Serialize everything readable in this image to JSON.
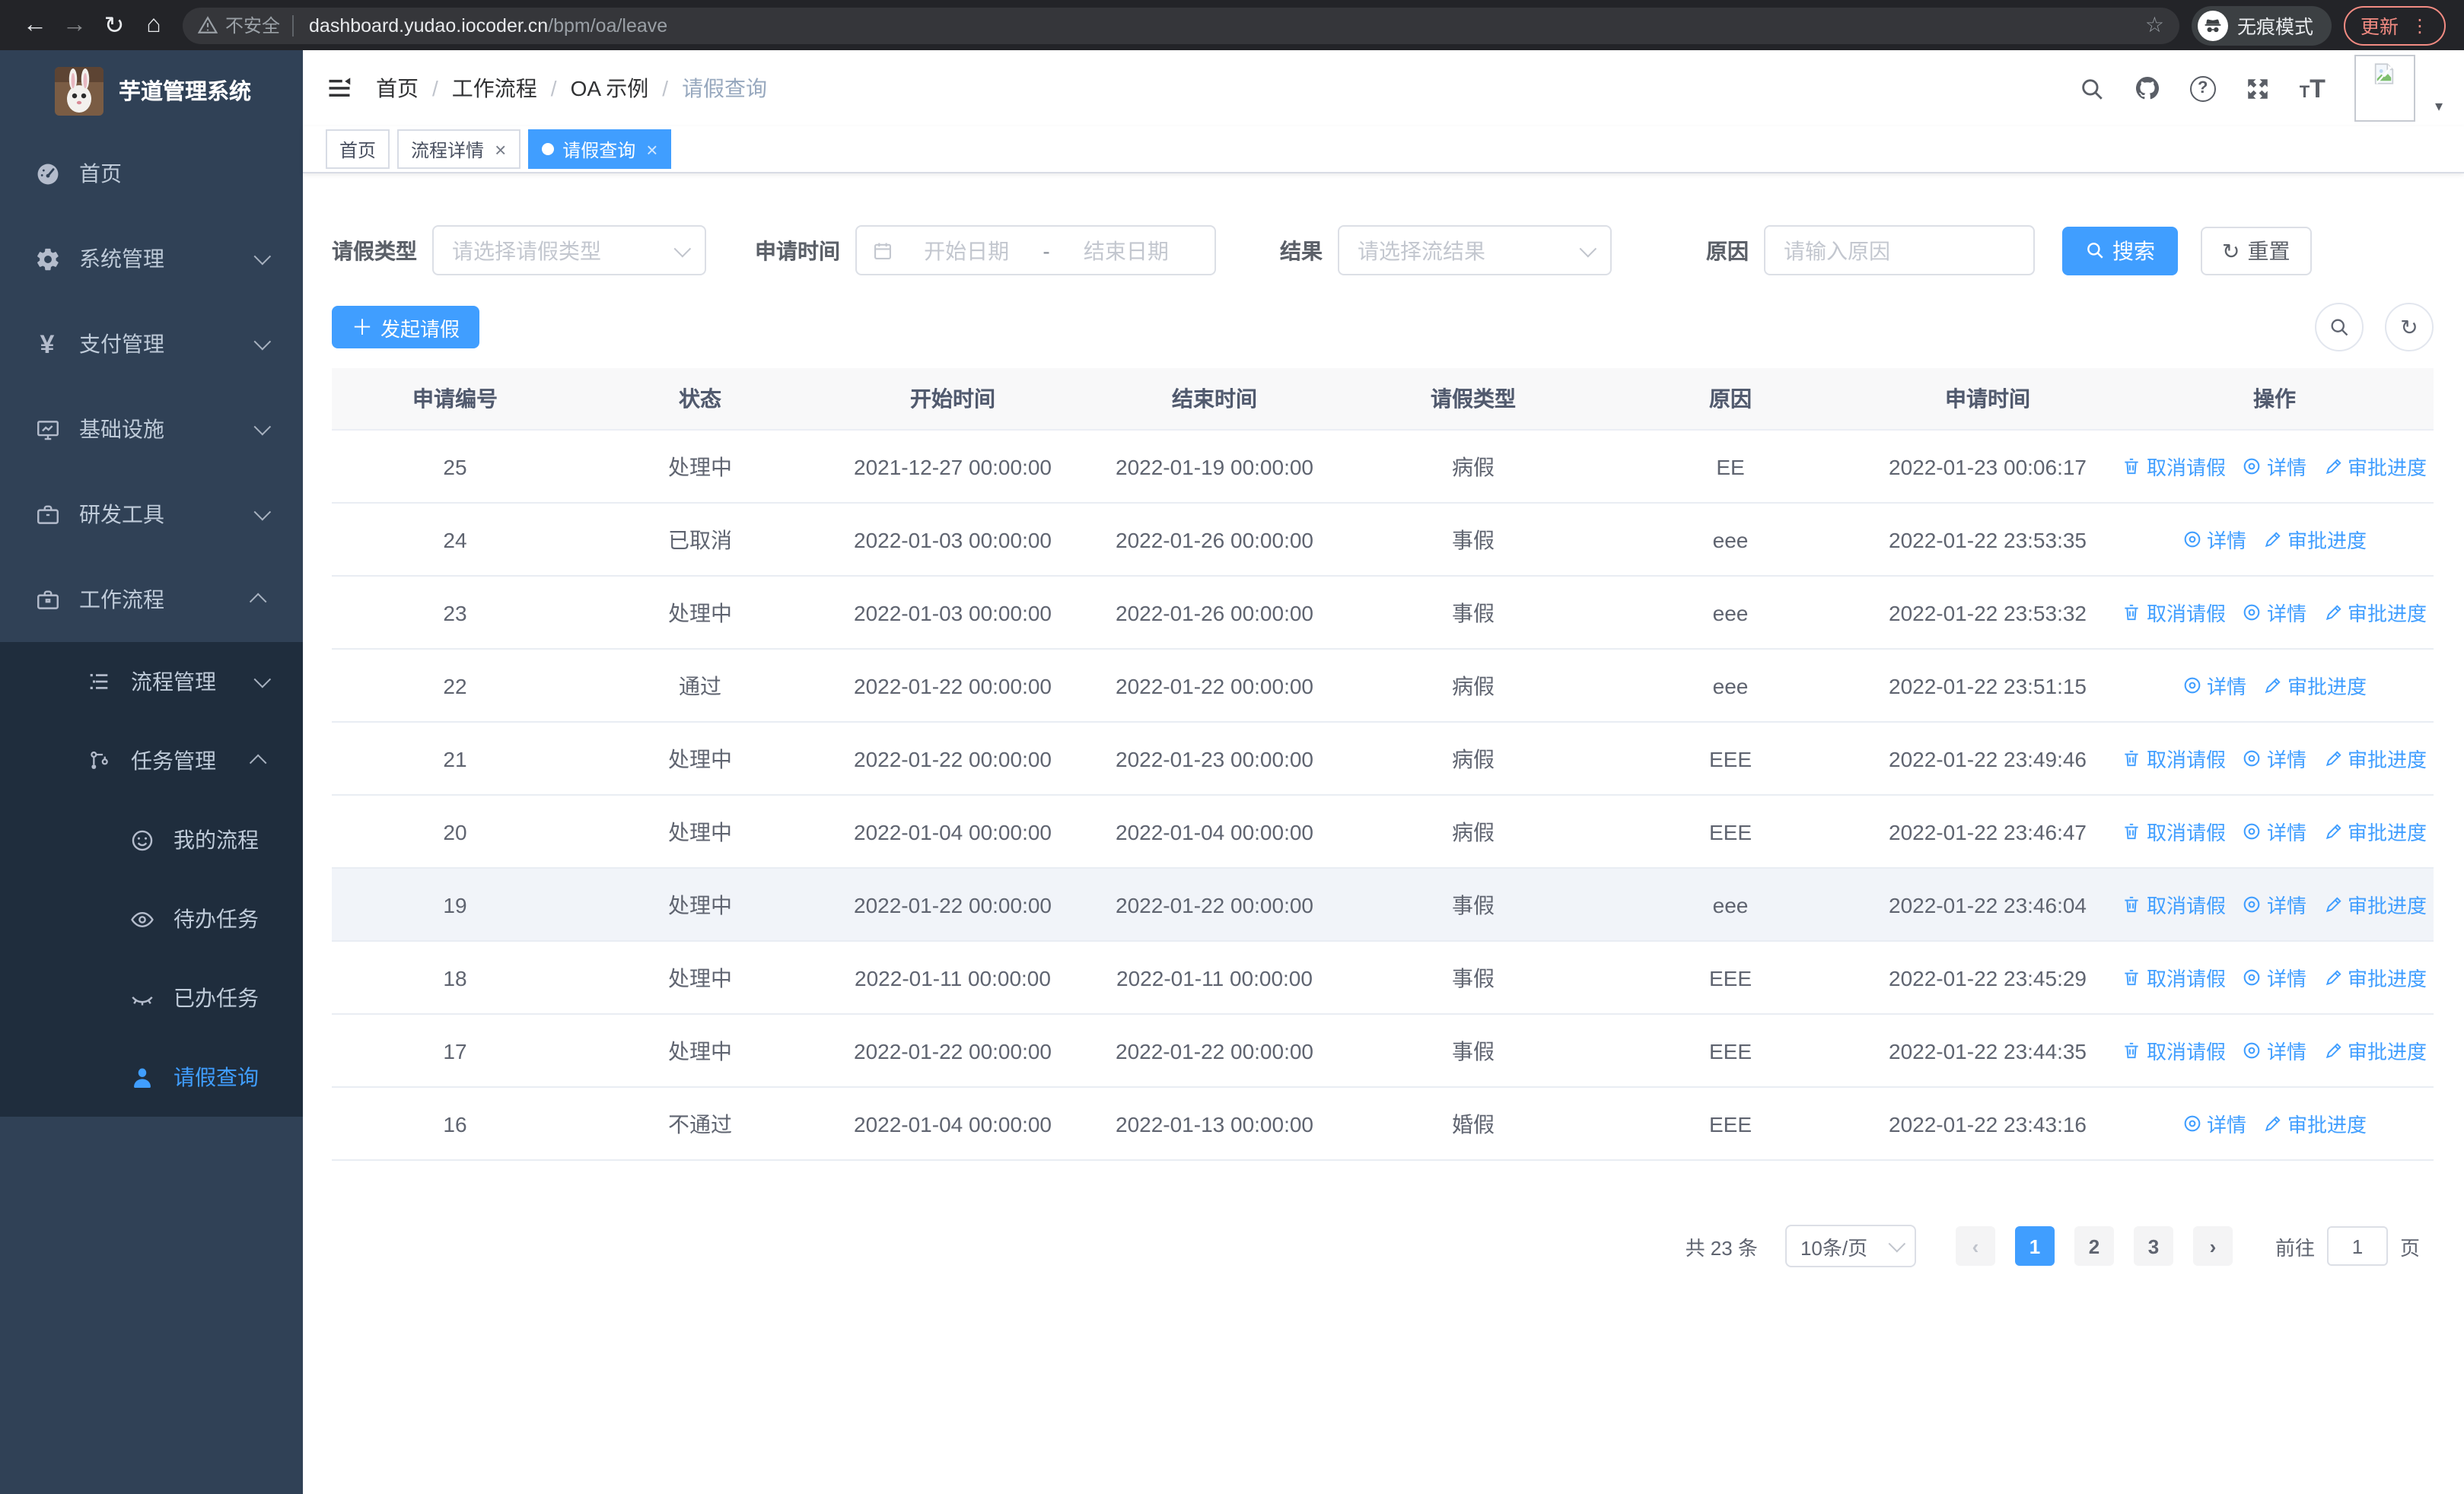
{
  "browser": {
    "security_label": "不安全",
    "url_domain": "dashboard.yudao.iocoder.cn",
    "url_path": "/bpm/oa/leave",
    "incognito_label": "无痕模式",
    "update_label": "更新"
  },
  "sidebar": {
    "title": "芋道管理系统",
    "menu": [
      {
        "label": "首页"
      },
      {
        "label": "系统管理"
      },
      {
        "label": "支付管理"
      },
      {
        "label": "基础设施"
      },
      {
        "label": "研发工具"
      },
      {
        "label": "工作流程"
      }
    ],
    "submenu": [
      {
        "label": "流程管理"
      },
      {
        "label": "任务管理"
      }
    ],
    "tasks": [
      {
        "label": "我的流程"
      },
      {
        "label": "待办任务"
      },
      {
        "label": "已办任务"
      },
      {
        "label": "请假查询"
      }
    ]
  },
  "navbar": {
    "breadcrumb": [
      "首页",
      "工作流程",
      "OA 示例",
      "请假查询"
    ]
  },
  "tabs": [
    {
      "label": "首页"
    },
    {
      "label": "流程详情"
    },
    {
      "label": "请假查询"
    }
  ],
  "filters": {
    "leave_type_label": "请假类型",
    "leave_type_placeholder": "请选择请假类型",
    "apply_time_label": "申请时间",
    "date_start_placeholder": "开始日期",
    "date_separator": "-",
    "date_end_placeholder": "结束日期",
    "result_label": "结果",
    "result_placeholder": "请选择流结果",
    "reason_label": "原因",
    "reason_placeholder": "请输入原因",
    "search_label": "搜索",
    "reset_label": "重置"
  },
  "toolbar": {
    "create_label": "发起请假"
  },
  "table": {
    "columns": [
      "申请编号",
      "状态",
      "开始时间",
      "结束时间",
      "请假类型",
      "原因",
      "申请时间",
      "操作"
    ],
    "action_labels": {
      "cancel": "取消请假",
      "detail": "详情",
      "progress": "审批进度"
    },
    "rows": [
      {
        "id": "25",
        "status": "处理中",
        "start": "2021-12-27 00:00:00",
        "end": "2022-01-19 00:00:00",
        "type": "病假",
        "reason": "EE",
        "applied": "2022-01-23 00:06:17",
        "cancellable": true,
        "highlight": false
      },
      {
        "id": "24",
        "status": "已取消",
        "start": "2022-01-03 00:00:00",
        "end": "2022-01-26 00:00:00",
        "type": "事假",
        "reason": "eee",
        "applied": "2022-01-22 23:53:35",
        "cancellable": false,
        "highlight": false
      },
      {
        "id": "23",
        "status": "处理中",
        "start": "2022-01-03 00:00:00",
        "end": "2022-01-26 00:00:00",
        "type": "事假",
        "reason": "eee",
        "applied": "2022-01-22 23:53:32",
        "cancellable": true,
        "highlight": false
      },
      {
        "id": "22",
        "status": "通过",
        "start": "2022-01-22 00:00:00",
        "end": "2022-01-22 00:00:00",
        "type": "病假",
        "reason": "eee",
        "applied": "2022-01-22 23:51:15",
        "cancellable": false,
        "highlight": false
      },
      {
        "id": "21",
        "status": "处理中",
        "start": "2022-01-22 00:00:00",
        "end": "2022-01-23 00:00:00",
        "type": "病假",
        "reason": "EEE",
        "applied": "2022-01-22 23:49:46",
        "cancellable": true,
        "highlight": false
      },
      {
        "id": "20",
        "status": "处理中",
        "start": "2022-01-04 00:00:00",
        "end": "2022-01-04 00:00:00",
        "type": "病假",
        "reason": "EEE",
        "applied": "2022-01-22 23:46:47",
        "cancellable": true,
        "highlight": false
      },
      {
        "id": "19",
        "status": "处理中",
        "start": "2022-01-22 00:00:00",
        "end": "2022-01-22 00:00:00",
        "type": "事假",
        "reason": "eee",
        "applied": "2022-01-22 23:46:04",
        "cancellable": true,
        "highlight": true
      },
      {
        "id": "18",
        "status": "处理中",
        "start": "2022-01-11 00:00:00",
        "end": "2022-01-11 00:00:00",
        "type": "事假",
        "reason": "EEE",
        "applied": "2022-01-22 23:45:29",
        "cancellable": true,
        "highlight": false
      },
      {
        "id": "17",
        "status": "处理中",
        "start": "2022-01-22 00:00:00",
        "end": "2022-01-22 00:00:00",
        "type": "事假",
        "reason": "EEE",
        "applied": "2022-01-22 23:44:35",
        "cancellable": true,
        "highlight": false
      },
      {
        "id": "16",
        "status": "不通过",
        "start": "2022-01-04 00:00:00",
        "end": "2022-01-13 00:00:00",
        "type": "婚假",
        "reason": "EEE",
        "applied": "2022-01-22 23:43:16",
        "cancellable": false,
        "highlight": false
      }
    ]
  },
  "pagination": {
    "total_label": "共 23 条",
    "page_size": "10条/页",
    "prev_icon": "‹",
    "next_icon": "›",
    "pages": [
      "1",
      "2",
      "3"
    ],
    "active_page": "1",
    "goto_label": "前往",
    "goto_value": "1",
    "page_unit": "页"
  },
  "colors": {
    "accent": "#409eff",
    "sidebar_bg": "#304156",
    "submenu_bg": "#1f2d3d",
    "update_accent": "#f28b82"
  }
}
